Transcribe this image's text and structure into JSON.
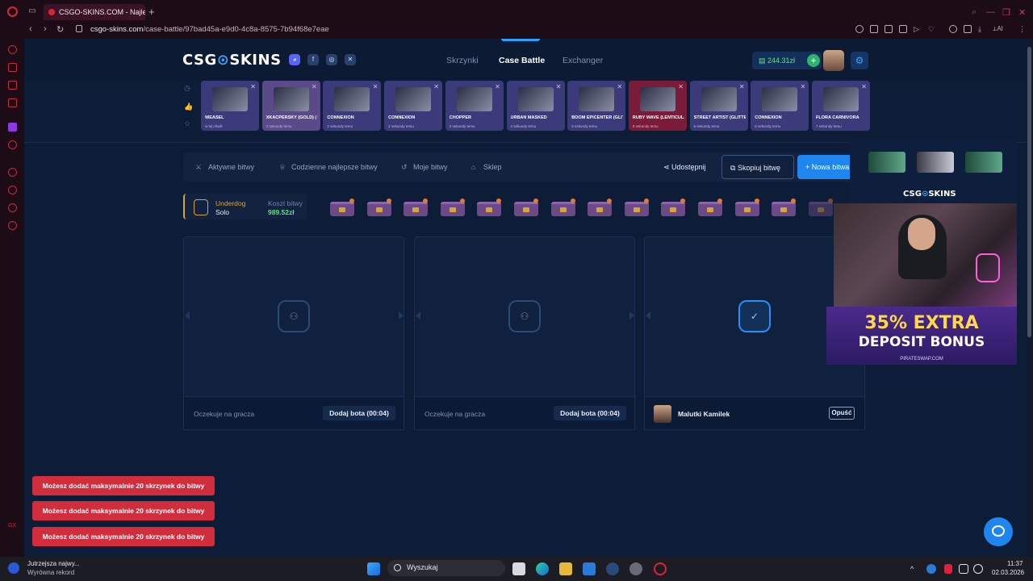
{
  "browser": {
    "tab_title": "CSGO-SKINS.COM - Najle",
    "url_host": "csgo-skins.com",
    "url_path": "/case-battle/97bad45a-e9d0-4c8a-8575-7b94f68e7eae"
  },
  "header": {
    "logo_left": "CSG",
    "logo_right": "SKINS",
    "nav": [
      "Skrzynki",
      "Case Battle",
      "Exchanger"
    ],
    "active_nav": "Case Battle",
    "balance": "244.31zł"
  },
  "live_drops": [
    {
      "name": "WEASEL",
      "time": "w tej chwili",
      "color": "#3b3a7a"
    },
    {
      "name": "XKACPERSKY (GOLD) | BUDAPEST 2025",
      "time": "1 sekundy temu",
      "color": "#5a4a8a"
    },
    {
      "name": "CONNEXION",
      "time": "2 sekundy temu",
      "color": "#3b3a7a"
    },
    {
      "name": "CONNEXION",
      "time": "2 sekundy temu",
      "color": "#3b3a7a"
    },
    {
      "name": "CHOPPER",
      "time": "3 sekundy temu",
      "color": "#3b3a7a"
    },
    {
      "name": "URBAN MASKED",
      "time": "4 sekundy temu",
      "color": "#3b3a7a"
    },
    {
      "name": "BOOM EPICENTER (GLITTER)",
      "time": "5 sekundy temu",
      "color": "#3b3a7a"
    },
    {
      "name": "RUBY WAVE (LENTICULAR)",
      "time": "5 sekundy temu",
      "color": "#7a1b3a"
    },
    {
      "name": "STREET ARTIST (GLITTER)",
      "time": "6 sekundy temu",
      "color": "#3b3a7a"
    },
    {
      "name": "CONNEXION",
      "time": "6 sekundy temu",
      "color": "#3b3a7a"
    },
    {
      "name": "FLORA CARNIVORA",
      "time": "7 sekundy temu",
      "color": "#3b3a7a"
    }
  ],
  "menu": {
    "active_battles": "Aktywne bitwy",
    "daily_best": "Codzienne najlepsze bitwy",
    "my_battles": "Moje bitwy",
    "shop": "Sklep",
    "share": "Udostępnij",
    "copy": "Skopiuj bitwę",
    "new": "Nowa bitwa"
  },
  "battle": {
    "mode": "Underdog",
    "type": "Solo",
    "cost_label": "Koszt bitwy",
    "cost": "989.52zł",
    "case_count": 14
  },
  "slots": [
    {
      "status": "Oczekuje na gracza",
      "bot_label": "Dodaj bota (00:04)"
    },
    {
      "status": "Oczekuje na gracza",
      "bot_label": "Dodaj bota (00:04)"
    },
    {
      "player": "Malutki Kamilek",
      "leave_label": "Opuść"
    }
  ],
  "toasts": [
    "Możesz dodać maksymalnie 20 skrzynek do bitwy",
    "Możesz dodać maksymalnie 20 skrzynek do bitwy",
    "Możesz dodać maksymalnie 20 skrzynek do bitwy"
  ],
  "overlay": {
    "logo_left": "CSG",
    "logo_right": "SKINS",
    "promo_line1": "35% EXTRA",
    "promo_line2": "DEPOSIT BONUS",
    "promo_site": "PIRATESWAP.COM"
  },
  "taskbar": {
    "notif_title": "Jutrzejsza najwy...",
    "notif_sub": "Wyrównа rekord",
    "search": "Wyszukaj",
    "time": "11:37",
    "date": "02.03.2026"
  }
}
